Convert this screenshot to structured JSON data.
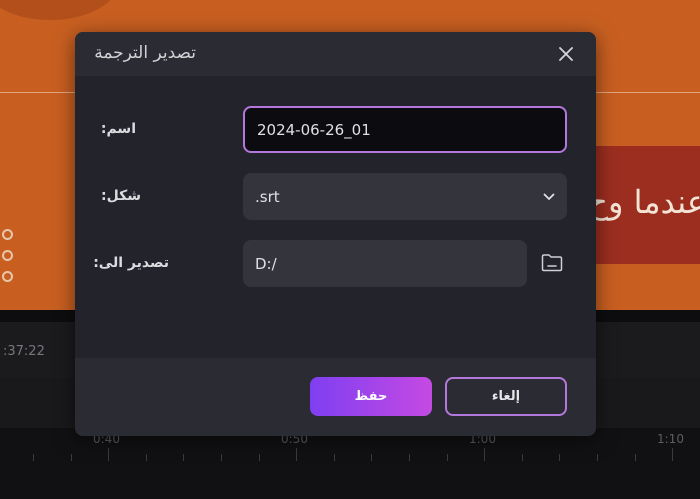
{
  "preview": {
    "caption_text": "عندما وح"
  },
  "timeline": {
    "timecode": ":37:22",
    "ruler_labels": [
      "0:40",
      "0:50",
      "1:00",
      "1:10"
    ]
  },
  "dialog": {
    "title": "تصدير الترجمة",
    "close_icon": "close-icon",
    "fields": {
      "name_label": "اسم:",
      "name_value": "2024-06-26_01",
      "format_label": "شكل:",
      "format_value": ".srt",
      "path_label": "تصدير الى:",
      "path_value": "D:/"
    },
    "buttons": {
      "save": "حفظ",
      "cancel": "إلغاء"
    },
    "accent_color": "#b478dc"
  }
}
